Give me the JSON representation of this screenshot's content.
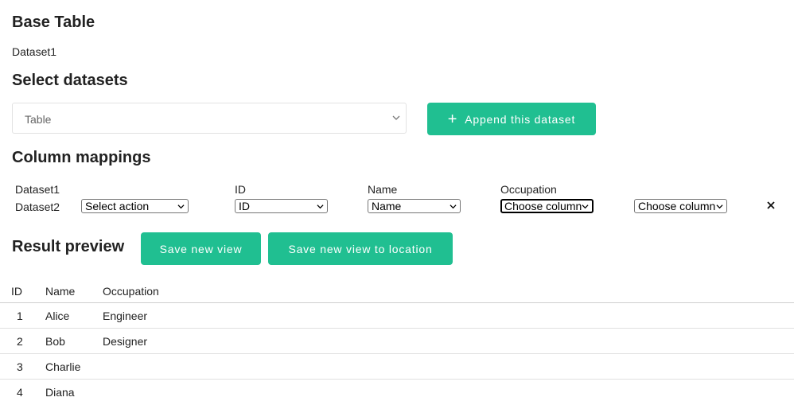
{
  "base_table": {
    "heading": "Base Table",
    "dataset_name": "Dataset1"
  },
  "select_datasets": {
    "heading": "Select datasets",
    "dropdown_value": "Table",
    "append_button": "Append this dataset"
  },
  "column_mappings": {
    "heading": "Column mappings",
    "row1_label": "Dataset1",
    "row2_label": "Dataset2",
    "columns": [
      "ID",
      "Name",
      "Occupation"
    ],
    "selects": [
      "Select action",
      "ID",
      "Name",
      "Choose column",
      "Choose column"
    ]
  },
  "result_preview": {
    "heading": "Result preview",
    "save_button": "Save new view",
    "save_location_button": "Save new view to location",
    "table": {
      "headers": [
        "ID",
        "Name",
        "Occupation"
      ],
      "rows": [
        [
          "1",
          "Alice",
          "Engineer"
        ],
        [
          "2",
          "Bob",
          "Designer"
        ],
        [
          "3",
          "Charlie",
          ""
        ],
        [
          "4",
          "Diana",
          ""
        ]
      ]
    }
  },
  "colors": {
    "accent": "#20bf91"
  }
}
